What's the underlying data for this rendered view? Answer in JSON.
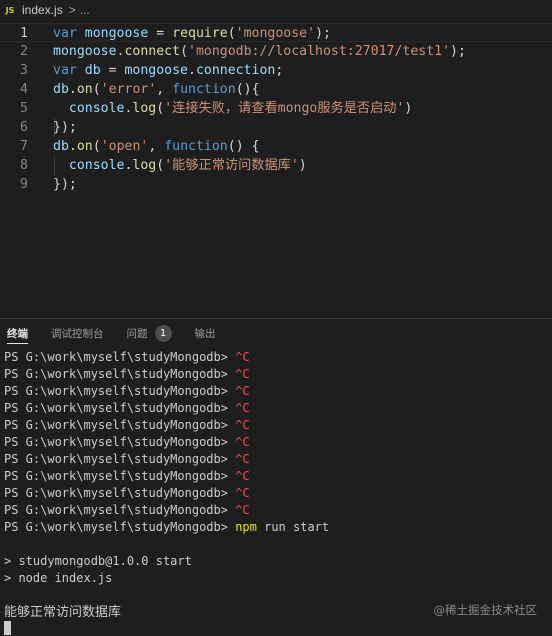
{
  "breadcrumb": {
    "icon": "JS",
    "file": "index.js",
    "sep": ">",
    "more": "..."
  },
  "editor": {
    "lines": [
      {
        "num": "1",
        "current": true,
        "tokens": [
          {
            "t": "var ",
            "c": "kw"
          },
          {
            "t": "mongoose",
            "c": "var"
          },
          {
            "t": " = ",
            "c": "pn"
          },
          {
            "t": "require",
            "c": "fn"
          },
          {
            "t": "(",
            "c": "pn"
          },
          {
            "t": "'mongoose'",
            "c": "str"
          },
          {
            "t": ");",
            "c": "pn"
          }
        ]
      },
      {
        "num": "2",
        "tokens": [
          {
            "t": "mongoose",
            "c": "var"
          },
          {
            "t": ".",
            "c": "pn"
          },
          {
            "t": "connect",
            "c": "fn"
          },
          {
            "t": "(",
            "c": "pn"
          },
          {
            "t": "'mongodb://localhost:27017/test1'",
            "c": "str"
          },
          {
            "t": ");",
            "c": "pn"
          }
        ]
      },
      {
        "num": "3",
        "tokens": [
          {
            "t": "var ",
            "c": "kw"
          },
          {
            "t": "db",
            "c": "var"
          },
          {
            "t": " = ",
            "c": "pn"
          },
          {
            "t": "mongoose",
            "c": "var"
          },
          {
            "t": ".",
            "c": "pn"
          },
          {
            "t": "connection",
            "c": "var"
          },
          {
            "t": ";",
            "c": "pn"
          }
        ]
      },
      {
        "num": "4",
        "tokens": [
          {
            "t": "db",
            "c": "var"
          },
          {
            "t": ".",
            "c": "pn"
          },
          {
            "t": "on",
            "c": "fn"
          },
          {
            "t": "(",
            "c": "pn"
          },
          {
            "t": "'error'",
            "c": "str"
          },
          {
            "t": ", ",
            "c": "pn"
          },
          {
            "t": "function",
            "c": "kw"
          },
          {
            "t": "(){",
            "c": "pn"
          }
        ]
      },
      {
        "num": "5",
        "tokens": [
          {
            "t": "  ",
            "c": "pn"
          },
          {
            "t": "console",
            "c": "var"
          },
          {
            "t": ".",
            "c": "pn"
          },
          {
            "t": "log",
            "c": "fn"
          },
          {
            "t": "(",
            "c": "pn"
          },
          {
            "t": "'连接失败，请查看mongo服务是否启动'",
            "c": "str"
          },
          {
            "t": ")",
            "c": "pn"
          }
        ]
      },
      {
        "num": "6",
        "tokens": [
          {
            "t": "});",
            "c": "pn"
          }
        ]
      },
      {
        "num": "7",
        "tokens": [
          {
            "t": "db",
            "c": "var"
          },
          {
            "t": ".",
            "c": "pn"
          },
          {
            "t": "on",
            "c": "fn"
          },
          {
            "t": "(",
            "c": "pn"
          },
          {
            "t": "'open'",
            "c": "str"
          },
          {
            "t": ", ",
            "c": "pn"
          },
          {
            "t": "function",
            "c": "kw"
          },
          {
            "t": "() {",
            "c": "pn"
          }
        ]
      },
      {
        "num": "8",
        "tokens": [
          {
            "t": "  ",
            "c": "pn"
          },
          {
            "t": "console",
            "c": "var"
          },
          {
            "t": ".",
            "c": "pn"
          },
          {
            "t": "log",
            "c": "fn"
          },
          {
            "t": "(",
            "c": "pn"
          },
          {
            "t": "'能够正常访问数据库'",
            "c": "str"
          },
          {
            "t": ")",
            "c": "pn"
          }
        ]
      },
      {
        "num": "9",
        "tokens": [
          {
            "t": "});",
            "c": "pn"
          }
        ]
      }
    ]
  },
  "panel": {
    "tabs": [
      {
        "label": "终端",
        "active": true
      },
      {
        "label": "调试控制台",
        "active": false
      },
      {
        "label": "问题",
        "active": false,
        "badge": "1"
      },
      {
        "label": "输出",
        "active": false
      }
    ]
  },
  "terminal": {
    "lines": [
      {
        "prompt": "PS G:\\work\\myself\\studyMongodb> ",
        "cmd": "^C",
        "style": "ctrlc"
      },
      {
        "prompt": "PS G:\\work\\myself\\studyMongodb> ",
        "cmd": "^C",
        "style": "ctrlc"
      },
      {
        "prompt": "PS G:\\work\\myself\\studyMongodb> ",
        "cmd": "^C",
        "style": "ctrlc"
      },
      {
        "prompt": "PS G:\\work\\myself\\studyMongodb> ",
        "cmd": "^C",
        "style": "ctrlc"
      },
      {
        "prompt": "PS G:\\work\\myself\\studyMongodb> ",
        "cmd": "^C",
        "style": "ctrlc"
      },
      {
        "prompt": "PS G:\\work\\myself\\studyMongodb> ",
        "cmd": "^C",
        "style": "ctrlc"
      },
      {
        "prompt": "PS G:\\work\\myself\\studyMongodb> ",
        "cmd": "^C",
        "style": "ctrlc"
      },
      {
        "prompt": "PS G:\\work\\myself\\studyMongodb> ",
        "cmd": "^C",
        "style": "ctrlc"
      },
      {
        "prompt": "PS G:\\work\\myself\\studyMongodb> ",
        "cmd": "^C",
        "style": "ctrlc"
      },
      {
        "prompt": "PS G:\\work\\myself\\studyMongodb> ",
        "cmd": "^C",
        "style": "ctrlc"
      },
      {
        "prompt": "PS G:\\work\\myself\\studyMongodb> ",
        "cmd": "npm",
        "rest": " run start",
        "style": "npm"
      },
      {
        "prompt": "",
        "cmd": "",
        "style": "plain"
      },
      {
        "prompt": "> studymongodb@1.0.0 start",
        "cmd": "",
        "style": "plain"
      },
      {
        "prompt": "> node index.js",
        "cmd": "",
        "style": "plain"
      },
      {
        "prompt": "",
        "cmd": "",
        "style": "plain"
      },
      {
        "prompt": "能够正常访问数据库",
        "cmd": "",
        "style": "cn"
      }
    ]
  },
  "watermark": "@稀土掘金技术社区"
}
